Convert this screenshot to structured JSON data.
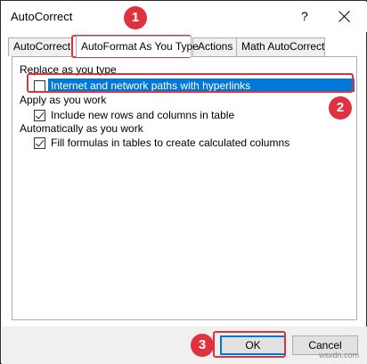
{
  "window": {
    "title": "AutoCorrect",
    "help_label": "?"
  },
  "tabs": [
    {
      "label": "AutoCorrect"
    },
    {
      "label": "AutoFormat As You Type"
    },
    {
      "label": "Actions"
    },
    {
      "label": "Math AutoCorrect"
    }
  ],
  "content": {
    "group1_label": "Replace as you type",
    "option1_label": "Internet and network paths with hyperlinks",
    "option1_checked": false,
    "group2_label": "Apply as you work",
    "option2_label": "Include new rows and columns in table",
    "option2_checked": true,
    "group3_label": "Automatically as you work",
    "option3_label": "Fill formulas in tables to create calculated columns",
    "option3_checked": true
  },
  "buttons": {
    "ok_label": "OK",
    "cancel_label": "Cancel"
  },
  "annotations": {
    "marker1": "1",
    "marker2": "2",
    "marker3": "3",
    "color": "#e0313f"
  },
  "watermark": "wsxdn.com"
}
